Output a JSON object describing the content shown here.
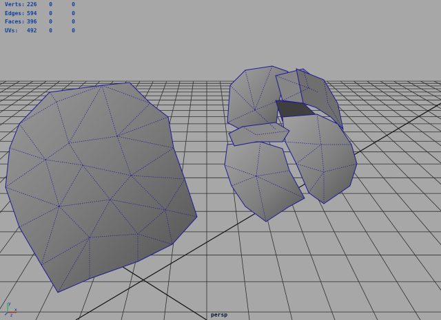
{
  "hud": {
    "rows": [
      {
        "label": "Verts:",
        "v1": "226",
        "v2": "0",
        "v3": "0"
      },
      {
        "label": "Edges:",
        "v1": "594",
        "v2": "0",
        "v3": "0"
      },
      {
        "label": "Faces:",
        "v1": "396",
        "v2": "0",
        "v3": "0"
      },
      {
        "label": "UVs:",
        "v1": "492",
        "v2": "0",
        "v3": "0"
      }
    ]
  },
  "camera": "persp",
  "axis": {
    "x": "x",
    "y": "y",
    "z": "z"
  },
  "colors": {
    "background": "#a7a7a7",
    "grid": "#2b2b2b",
    "mesh_fill": "#7c7c7c",
    "wire": "#1e1a95",
    "hud_text": "#0f3f9e"
  },
  "icons": {
    "axis": "view-axis-icon"
  }
}
